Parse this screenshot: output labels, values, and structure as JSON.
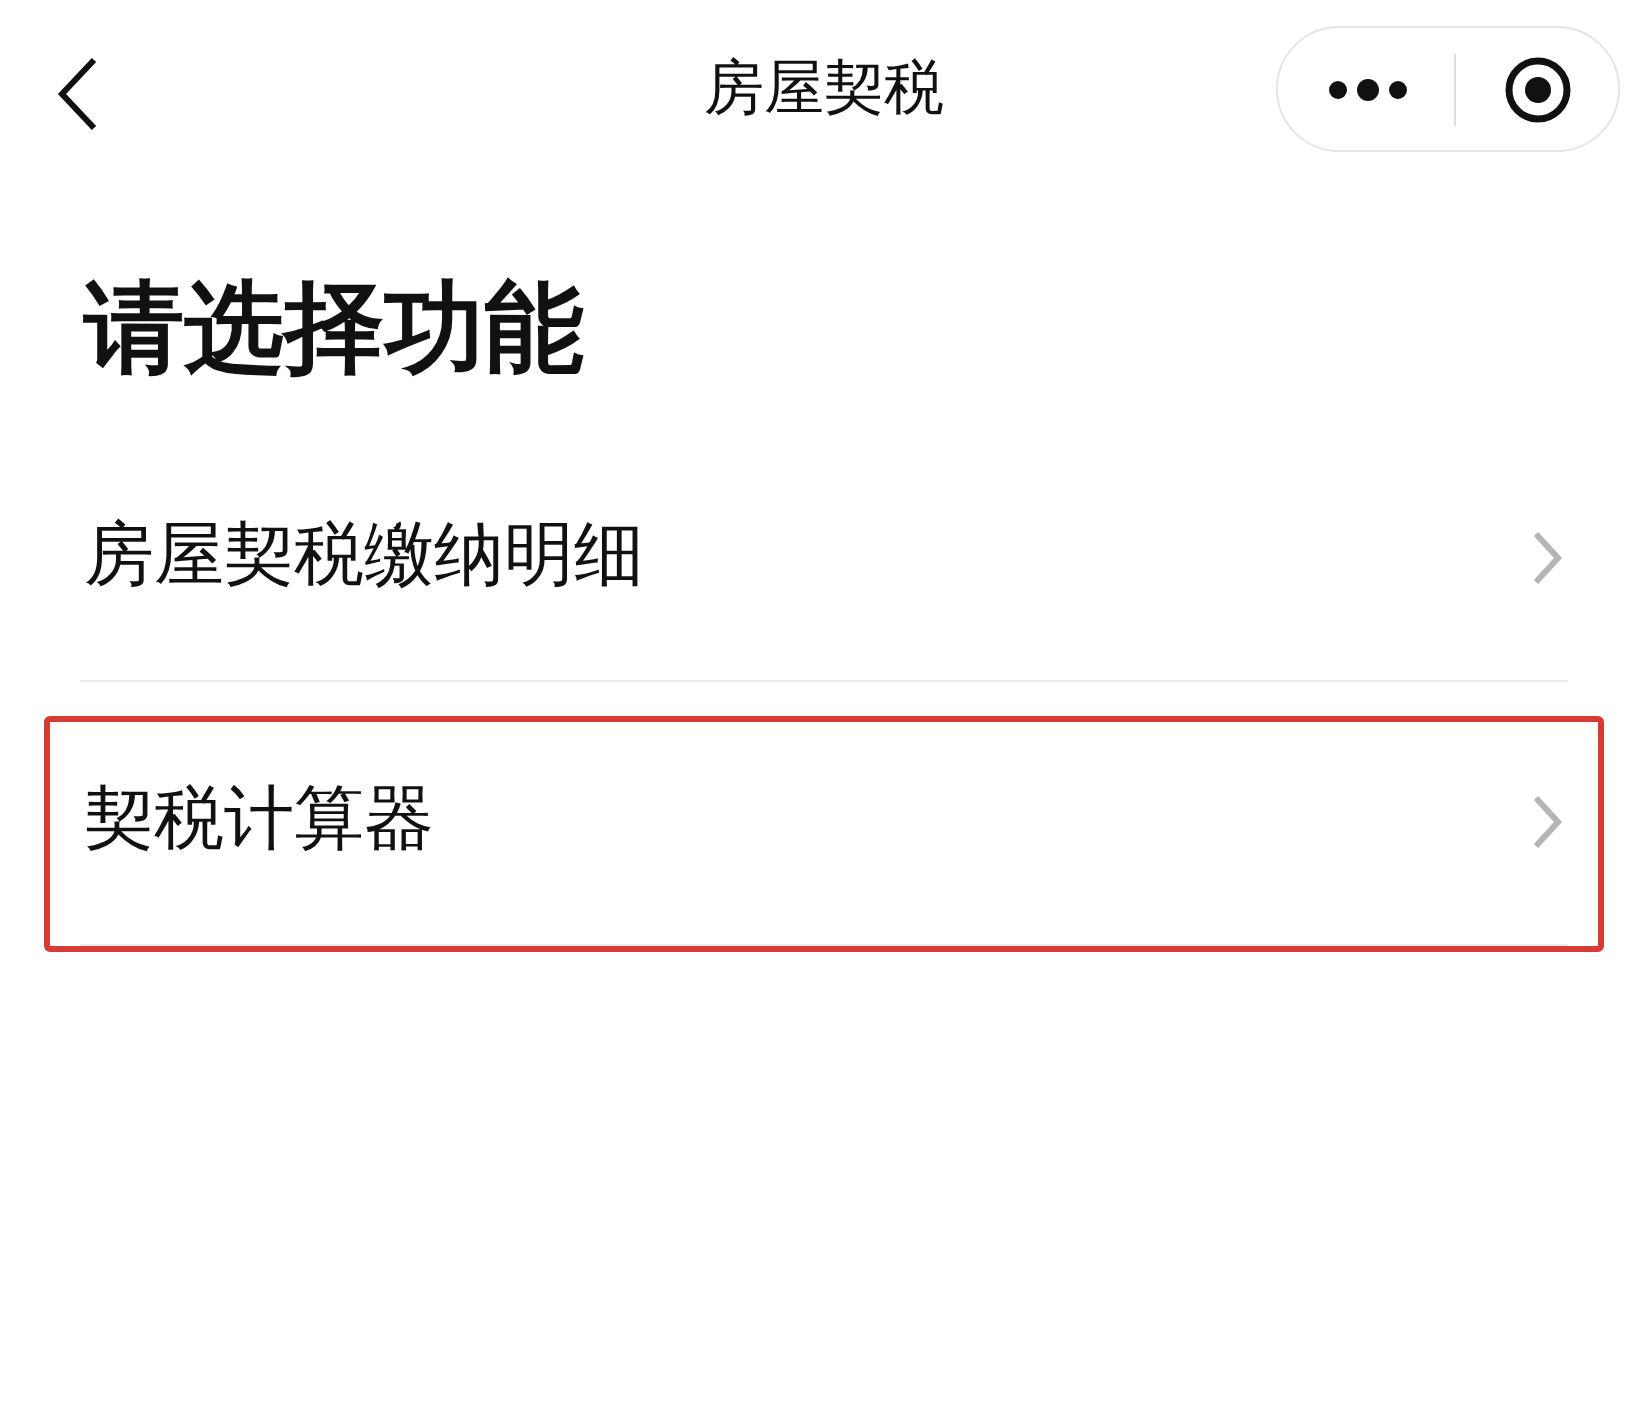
{
  "nav_bar": {
    "title": "房屋契税"
  },
  "heading": "请选择功能",
  "menu_items": [
    {
      "label": "房屋契税缴纳明细",
      "highlighted": false
    },
    {
      "label": "契税计算器",
      "highlighted": true
    }
  ]
}
